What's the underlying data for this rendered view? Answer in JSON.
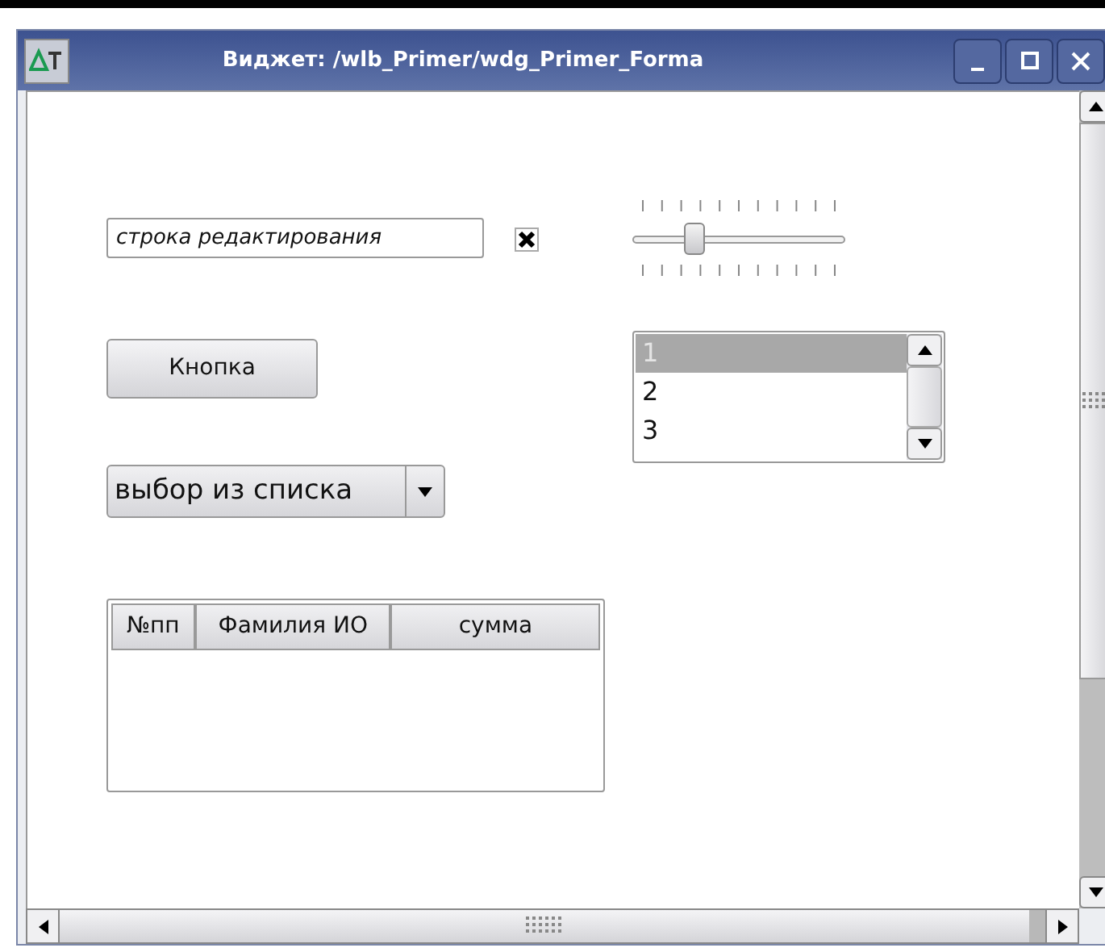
{
  "window": {
    "title": "Виджет: /wlb_Primer/wdg_Primer_Forma"
  },
  "line_edit": {
    "value": "строка редактирования"
  },
  "checkbox": {
    "checked": true
  },
  "slider": {
    "level": 0.27
  },
  "button": {
    "label": "Кнопка"
  },
  "list": {
    "items": [
      {
        "label": "1",
        "selected": true
      },
      {
        "label": "2",
        "selected": false
      },
      {
        "label": "3",
        "selected": false
      }
    ]
  },
  "combobox": {
    "value": "выбор из списка"
  },
  "table": {
    "columns": [
      "№пп",
      "Фамилия ИО",
      "сумма"
    ]
  }
}
